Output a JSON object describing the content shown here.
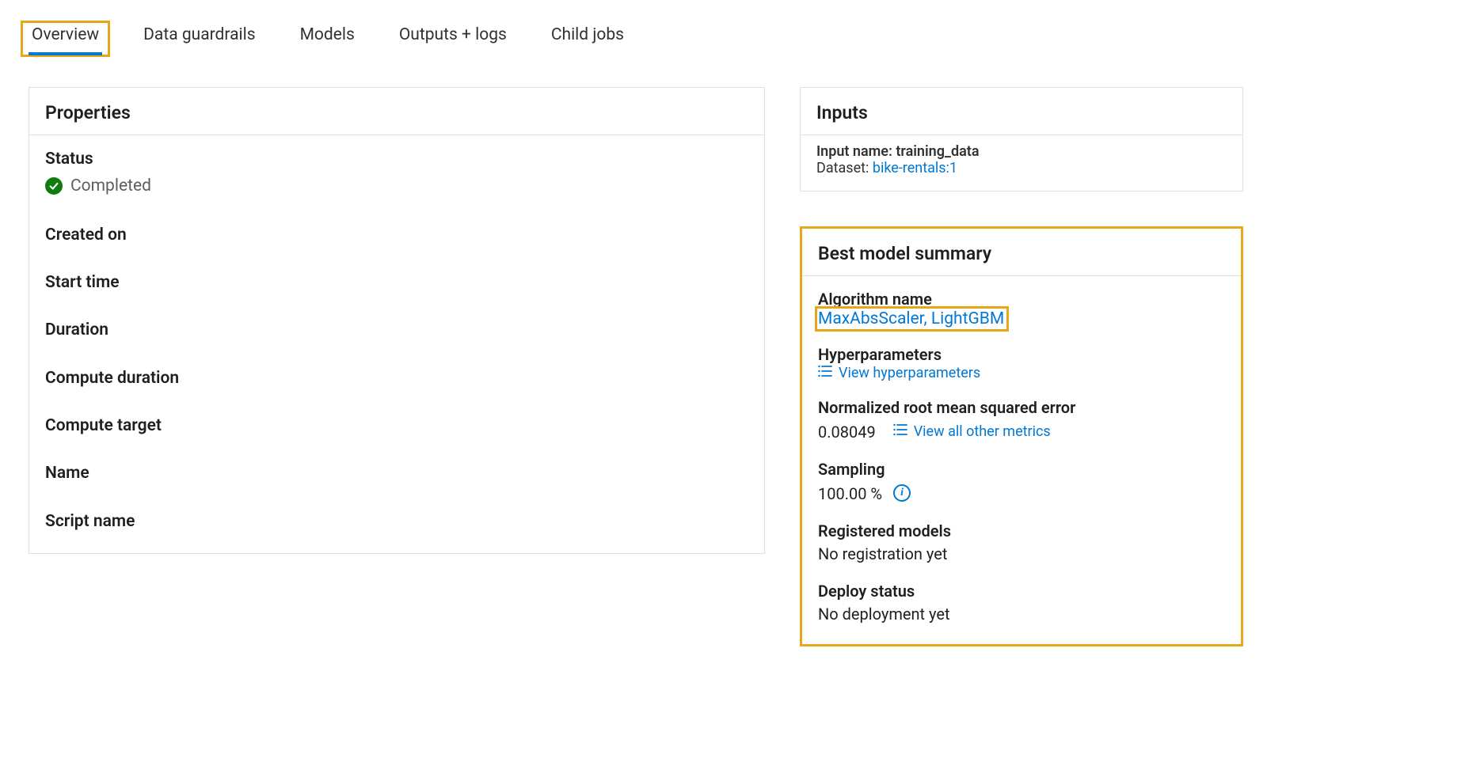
{
  "tabs": {
    "overview": "Overview",
    "data_guardrails": "Data guardrails",
    "models": "Models",
    "outputs_logs": "Outputs + logs",
    "child_jobs": "Child jobs"
  },
  "properties": {
    "panel_title": "Properties",
    "status_label": "Status",
    "status_value": "Completed",
    "created_on_label": "Created on",
    "created_on_value": "",
    "start_time_label": "Start time",
    "start_time_value": "",
    "duration_label": "Duration",
    "duration_value": "",
    "compute_duration_label": "Compute duration",
    "compute_duration_value": "",
    "compute_target_label": "Compute target",
    "compute_target_value": "",
    "name_label": "Name",
    "name_value": "",
    "script_name_label": "Script name",
    "script_name_value": ""
  },
  "inputs": {
    "panel_title": "Inputs",
    "input_name_label": "Input name:",
    "input_name_value": "training_data",
    "dataset_label": "Dataset:",
    "dataset_link": "bike-rentals:1"
  },
  "best_model": {
    "panel_title": "Best model summary",
    "algorithm_label": "Algorithm name",
    "algorithm_value": "MaxAbsScaler, LightGBM",
    "hyperparameters_label": "Hyperparameters",
    "hyperparameters_link": "View hyperparameters",
    "nrmse_label": "Normalized root mean squared error",
    "nrmse_value": "0.08049",
    "view_metrics_link": "View all other metrics",
    "sampling_label": "Sampling",
    "sampling_value": "100.00 %",
    "registered_models_label": "Registered models",
    "registered_models_value": "No registration yet",
    "deploy_status_label": "Deploy status",
    "deploy_status_value": "No deployment yet"
  }
}
